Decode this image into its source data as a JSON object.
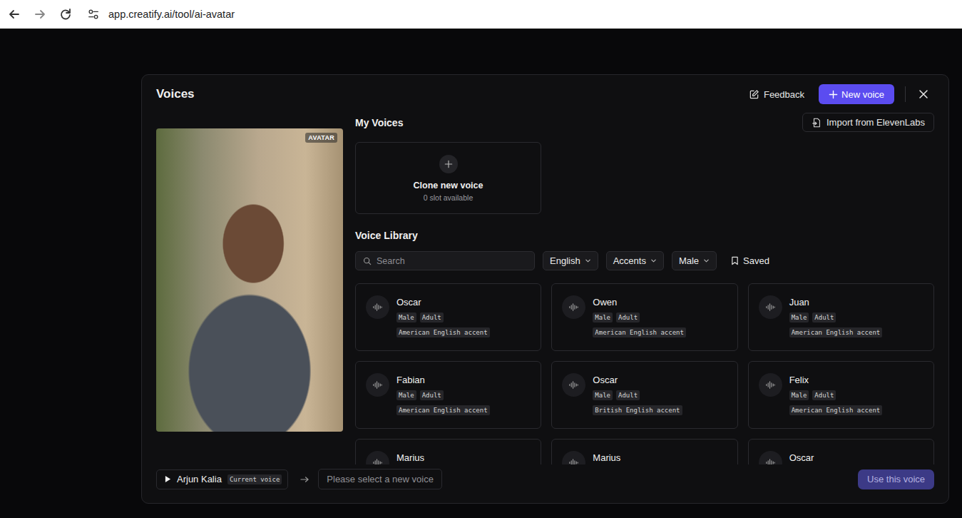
{
  "browser": {
    "url": "app.creatify.ai/tool/ai-avatar"
  },
  "modal": {
    "title": "Voices",
    "feedback_button": "Feedback",
    "new_voice_button": "New voice"
  },
  "avatar": {
    "badge": "AVATAR"
  },
  "my_voices": {
    "heading": "My Voices",
    "import_button": "Import from ElevenLabs",
    "clone_card": {
      "title": "Clone new voice",
      "slots": "0 slot available"
    }
  },
  "library": {
    "heading": "Voice Library",
    "search": {
      "placeholder": "Search"
    },
    "filters": [
      {
        "label": "English",
        "kind": "dropdown"
      },
      {
        "label": "Accents",
        "kind": "dropdown"
      },
      {
        "label": "Male",
        "kind": "dropdown"
      },
      {
        "label": "Saved",
        "kind": "toggle"
      }
    ],
    "voices": [
      {
        "name": "Oscar",
        "tags": [
          "Male",
          "Adult"
        ],
        "accent": "American English accent",
        "selected": false
      },
      {
        "name": "Owen",
        "tags": [
          "Male",
          "Adult"
        ],
        "accent": "American English accent",
        "selected": false
      },
      {
        "name": "Juan",
        "tags": [
          "Male",
          "Adult"
        ],
        "accent": "American English accent",
        "selected": false
      },
      {
        "name": "Fabian",
        "tags": [
          "Male",
          "Adult"
        ],
        "accent": "American English accent",
        "selected": false
      },
      {
        "name": "Oscar",
        "tags": [
          "Male",
          "Adult"
        ],
        "accent": "British English accent",
        "selected": false
      },
      {
        "name": "Felix",
        "tags": [
          "Male",
          "Adult"
        ],
        "accent": "American English accent",
        "selected": false
      },
      {
        "name": "Marius",
        "tags": [],
        "accent": "",
        "selected": false
      },
      {
        "name": "Marius",
        "tags": [],
        "accent": "",
        "selected": false
      },
      {
        "name": "Oscar",
        "tags": [],
        "accent": "",
        "selected": false
      }
    ]
  },
  "footer": {
    "current_voice": {
      "name": "Arjun Kalia",
      "badge": "Current voice"
    },
    "new_voice_placeholder": "Please select a new voice",
    "use_button": {
      "label": "Use this voice",
      "disabled": true
    }
  }
}
